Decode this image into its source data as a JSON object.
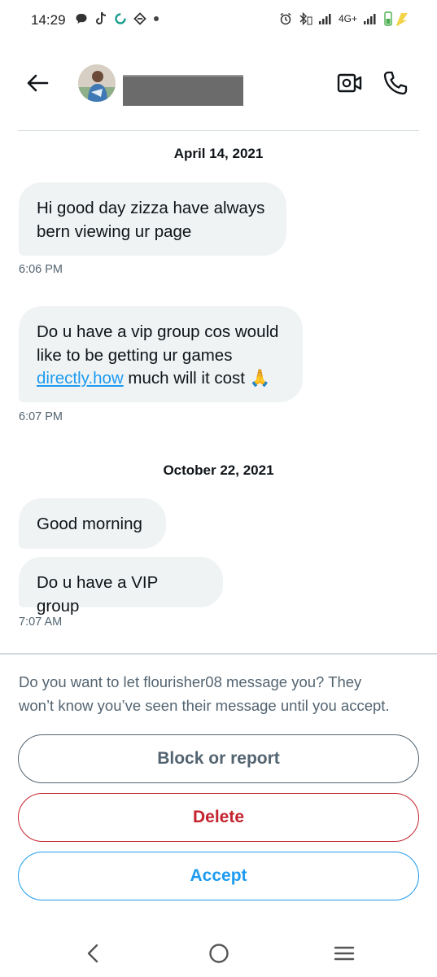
{
  "status_bar": {
    "time": "14:29",
    "network_label": "4G+",
    "icons": [
      "chat-bubble-icon",
      "tiktok-icon",
      "sync-icon",
      "tag-icon",
      "dot-icon",
      "alarm-icon",
      "bluetooth-icon",
      "signal-icon",
      "battery-icon"
    ]
  },
  "header": {
    "back_icon": "arrow-left-icon",
    "video_icon": "video-icon",
    "call_icon": "phone-icon"
  },
  "conversation": {
    "day1_label": "April 14, 2021",
    "day2_label": "October 22, 2021",
    "m1_line1": "Hi good day zizza have always",
    "m1_line2": "bern viewing ur page",
    "m1_time": "6:06 PM",
    "m2_line1": "Do u have a vip group cos would",
    "m2_line2": "like to be getting ur games",
    "m2_link": "directly.how",
    "m2_line3_rest": " much will it cost 🙏",
    "m2_time": "6:07 PM",
    "m3_text": "Good morning",
    "m4_text": "Do u have a VIP group",
    "m4_time": "7:07 AM"
  },
  "request": {
    "prompt_line1": "Do you want to let flourisher08 message you? They",
    "prompt_line2": "won’t know you’ve seen their message until you accept.",
    "block_label": "Block or report",
    "delete_label": "Delete",
    "accept_label": "Accept"
  },
  "colors": {
    "accent": "#1d9bf0",
    "danger": "#c4242e",
    "secondary_text": "#536471",
    "bubble_bg": "#eff3f4"
  }
}
